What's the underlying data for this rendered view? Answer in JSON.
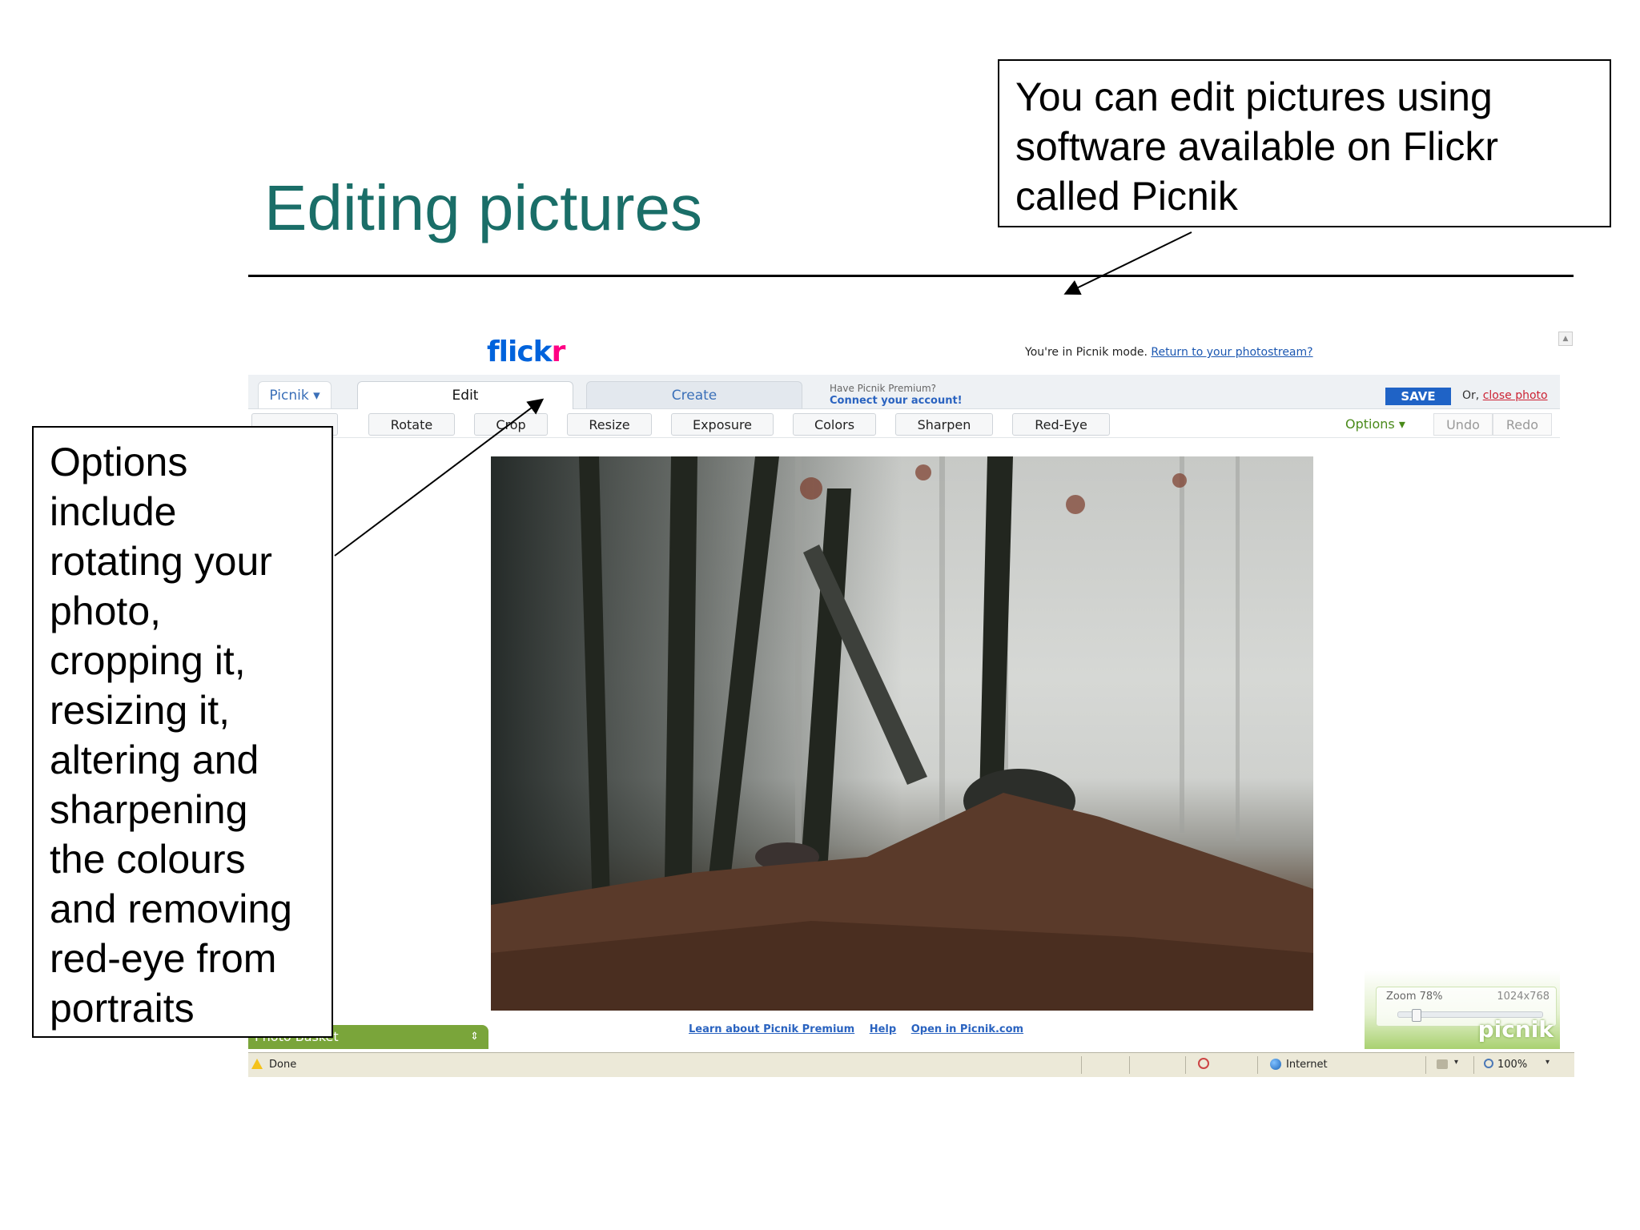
{
  "slide": {
    "title": "Editing pictures",
    "callout_top_lines": [
      "You can edit pictures using",
      "software available on Flickr",
      "called Picnik"
    ],
    "callout_left_lines": [
      "Options",
      "include",
      "rotating your",
      "photo,",
      "cropping it,",
      "resizing it,",
      "altering and",
      "sharpening",
      "the colours",
      "and removing",
      "red-eye from",
      "portraits"
    ]
  },
  "browser": {
    "logo": {
      "part1": "flick",
      "part2": "r"
    },
    "picnik_mode_text": "You're in Picnik mode.",
    "picnik_mode_link": "Return to your photostream?",
    "tabs": {
      "picnik": "Picnik ▾",
      "edit": "Edit",
      "create": "Create"
    },
    "premium": {
      "question": "Have Picnik Premium?",
      "connect": "Connect your account!"
    },
    "save_label": "SAVE",
    "or_label": "Or,",
    "close_photo_label": "close photo",
    "toolbar": {
      "buttons": [
        "Rotate",
        "Crop",
        "Resize",
        "Exposure",
        "Colors",
        "Sharpen",
        "Red-Eye"
      ],
      "options_label": "Options ▾",
      "undo_label": "Undo",
      "redo_label": "Redo"
    },
    "photo_basket_label": "Photo Basket",
    "basket_arrows": "⇕",
    "footer_links": [
      "Learn about Picnik Premium",
      "Help",
      "Open in Picnik.com"
    ],
    "zoom_label": "Zoom 78%",
    "zoom_fraction": 0.1,
    "dimensions": "1024x768",
    "picnik_logo": "picnik",
    "status": {
      "done": "Done",
      "zone": "Internet",
      "zoom": "100%",
      "dropdown": "▾"
    }
  },
  "colors": {
    "title": "#1a6e68",
    "flickr_blue": "#0063dc",
    "flickr_pink": "#ff0084",
    "save_blue": "#1f63c6",
    "link_red": "#cc2233",
    "options_green": "#4a8a1a"
  }
}
